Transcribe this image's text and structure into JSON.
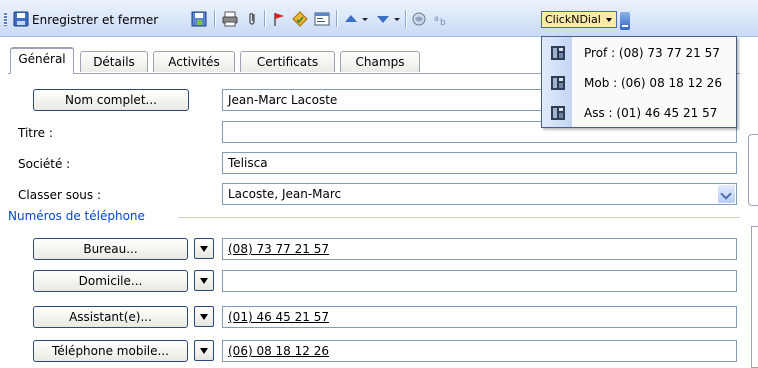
{
  "toolbar": {
    "save_close_label": "Enregistrer et fermer",
    "clickndial_label": "ClickNDial"
  },
  "tabs": [
    {
      "label": "Général",
      "active": true
    },
    {
      "label": "Détails",
      "active": false
    },
    {
      "label": "Activités",
      "active": false
    },
    {
      "label": "Certificats",
      "active": false
    },
    {
      "label": "Champs",
      "active": false
    }
  ],
  "form": {
    "full_name_button": "Nom complet...",
    "full_name_value": "Jean-Marc Lacoste",
    "title_label": "Titre :",
    "title_value": "",
    "company_label": "Société :",
    "company_value": "Telisca",
    "file_as_label": "Classer sous :",
    "file_as_value": "Lacoste, Jean-Marc"
  },
  "phones": {
    "group_label": "Numéros de téléphone",
    "rows": [
      {
        "button": "Bureau...",
        "value": "(08) 73 77 21 57"
      },
      {
        "button": "Domicile...",
        "value": ""
      },
      {
        "button": "Assistant(e)...",
        "value": "(01) 46 45 21 57"
      },
      {
        "button": "Téléphone mobile...",
        "value": "(06) 08 18 12 26"
      }
    ]
  },
  "menu": {
    "items": [
      {
        "label": "Prof : (08) 73 77 21 57",
        "icon": "phone-icon"
      },
      {
        "label": "Mob : (06) 08 18 12 26",
        "icon": "phone-icon"
      },
      {
        "label": "Ass : (01) 46 45 21 57",
        "icon": "phone-icon"
      }
    ]
  }
}
